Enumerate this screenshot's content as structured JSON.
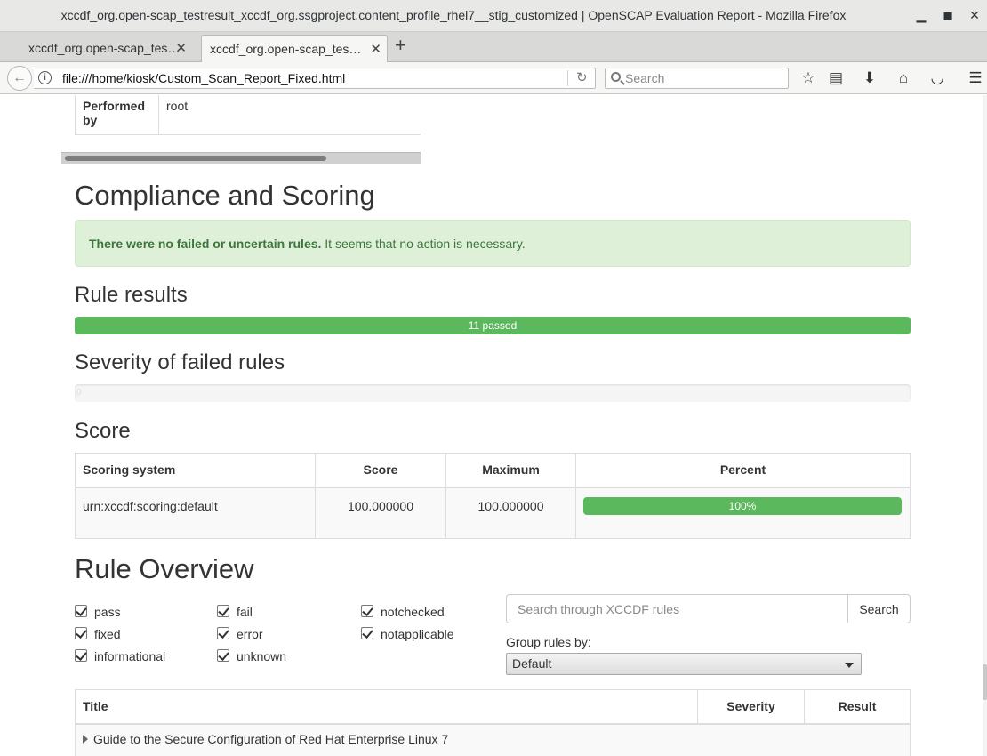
{
  "window": {
    "title": "xccdf_org.open-scap_testresult_xccdf_org.ssgproject.content_profile_rhel7__stig_customized | OpenSCAP Evaluation Report - Mozilla Firefox"
  },
  "tabs": [
    {
      "label": "xccdf_org.open-scap_tes…",
      "active": false
    },
    {
      "label": "xccdf_org.open-scap_tes…",
      "active": true
    }
  ],
  "navbar": {
    "url": "file:///home/kiosk/Custom_Scan_Report_Fixed.html",
    "search_placeholder": "Search"
  },
  "evaluation": {
    "performed_by_label": "Performed by",
    "performed_by_value": "root"
  },
  "compliance": {
    "heading": "Compliance and Scoring",
    "alert_bold": "There were no failed or uncertain rules.",
    "alert_text": " It seems that no action is necessary.",
    "rule_results_heading": "Rule results",
    "rule_results_bar": "11 passed",
    "passed_fraction": 1.0,
    "severity_heading": "Severity of failed rules",
    "severity_bar": "0"
  },
  "score": {
    "heading": "Score",
    "headers": [
      "Scoring system",
      "Score",
      "Maximum",
      "Percent"
    ],
    "row": {
      "system": "urn:xccdf:scoring:default",
      "score": "100.000000",
      "maximum": "100.000000",
      "percent": "100%"
    }
  },
  "overview": {
    "heading": "Rule Overview",
    "filters": [
      {
        "label": "pass",
        "checked": true
      },
      {
        "label": "fail",
        "checked": true
      },
      {
        "label": "notchecked",
        "checked": true
      },
      {
        "label": "fixed",
        "checked": true
      },
      {
        "label": "error",
        "checked": true
      },
      {
        "label": "notapplicable",
        "checked": true
      },
      {
        "label": "informational",
        "checked": true
      },
      {
        "label": "unknown",
        "checked": true
      }
    ],
    "search_placeholder": "Search through XCCDF rules",
    "search_button": "Search",
    "group_label": "Group rules by:",
    "group_value": "Default",
    "table_headers": [
      "Title",
      "Severity",
      "Result"
    ],
    "first_group": "Guide to the Secure Configuration of Red Hat Enterprise Linux 7"
  },
  "colors": {
    "success": "#5cb85c",
    "alert_bg": "#dff0d8",
    "alert_text": "#3c763d"
  }
}
